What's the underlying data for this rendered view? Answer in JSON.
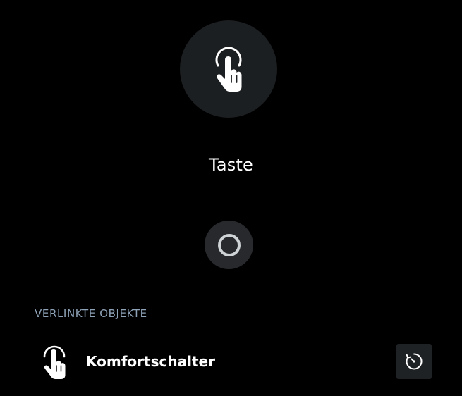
{
  "device": {
    "title": "Taste",
    "icon": "hand-tap-icon"
  },
  "toggle": {
    "icon": "ring-icon",
    "ring_color": "#cfd3d6"
  },
  "linked_objects": {
    "heading": "VERLINKTE OBJEKTE",
    "items": [
      {
        "label": "Komfortschalter",
        "icon": "hand-tap-icon",
        "action_icon": "timer-icon"
      }
    ]
  },
  "colors": {
    "background": "#000000",
    "hero_circle": "#1c1f21",
    "toggle_bg": "#27292c",
    "section_heading": "#8fa3b8",
    "action_button_bg": "#1f2225"
  }
}
